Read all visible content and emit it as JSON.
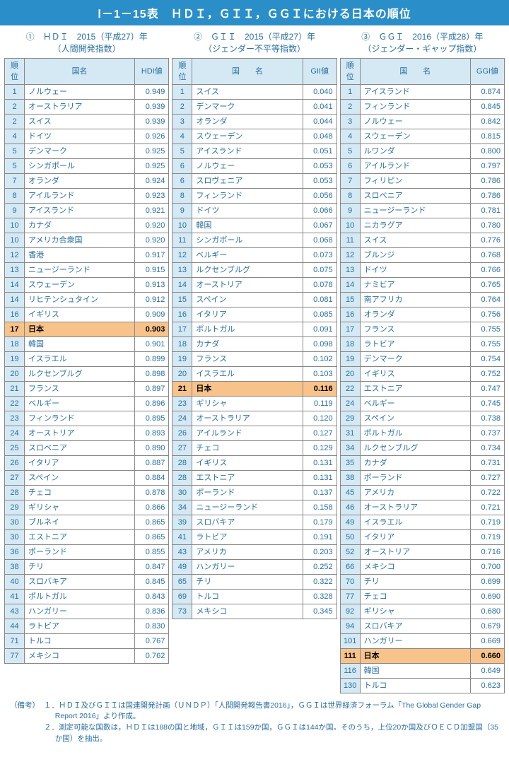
{
  "title": "Ⅰ－1－15表　ＨＤＩ，ＧＩＩ，ＧＧＩにおける日本の順位",
  "columns": [
    {
      "heading_num": "①",
      "heading_main": "ＨＤＩ　2015（平成27）年",
      "heading_sub": "（人間開発指数）",
      "head_rank": "順位",
      "head_name": "国名",
      "head_val": "HDI値",
      "rows": [
        {
          "rank": "1",
          "name": "ノルウェー",
          "val": "0.949"
        },
        {
          "rank": "2",
          "name": "オーストラリア",
          "val": "0.939"
        },
        {
          "rank": "2",
          "name": "スイス",
          "val": "0.939"
        },
        {
          "rank": "4",
          "name": "ドイツ",
          "val": "0.926"
        },
        {
          "rank": "5",
          "name": "デンマーク",
          "val": "0.925"
        },
        {
          "rank": "5",
          "name": "シンガポール",
          "val": "0.925"
        },
        {
          "rank": "7",
          "name": "オランダ",
          "val": "0.924"
        },
        {
          "rank": "8",
          "name": "アイルランド",
          "val": "0.923"
        },
        {
          "rank": "9",
          "name": "アイスランド",
          "val": "0.921"
        },
        {
          "rank": "10",
          "name": "カナダ",
          "val": "0.920"
        },
        {
          "rank": "10",
          "name": "アメリカ合衆国",
          "val": "0.920"
        },
        {
          "rank": "12",
          "name": "香港",
          "val": "0.917"
        },
        {
          "rank": "13",
          "name": "ニュージーランド",
          "val": "0.915"
        },
        {
          "rank": "14",
          "name": "スウェーデン",
          "val": "0.913"
        },
        {
          "rank": "14",
          "name": "リヒテンシュタイン",
          "val": "0.912"
        },
        {
          "rank": "16",
          "name": "イギリス",
          "val": "0.909"
        },
        {
          "rank": "17",
          "name": "日本",
          "val": "0.903",
          "hl": true
        },
        {
          "rank": "18",
          "name": "韓国",
          "val": "0.901"
        },
        {
          "rank": "19",
          "name": "イスラエル",
          "val": "0.899"
        },
        {
          "rank": "20",
          "name": "ルクセンブルグ",
          "val": "0.898"
        },
        {
          "rank": "21",
          "name": "フランス",
          "val": "0.897"
        },
        {
          "rank": "22",
          "name": "ベルギー",
          "val": "0.896"
        },
        {
          "rank": "23",
          "name": "フィンランド",
          "val": "0.895"
        },
        {
          "rank": "24",
          "name": "オーストリア",
          "val": "0.893"
        },
        {
          "rank": "25",
          "name": "スロベニア",
          "val": "0.890"
        },
        {
          "rank": "26",
          "name": "イタリア",
          "val": "0.887"
        },
        {
          "rank": "27",
          "name": "スペイン",
          "val": "0.884"
        },
        {
          "rank": "28",
          "name": "チェコ",
          "val": "0.878"
        },
        {
          "rank": "29",
          "name": "ギリシャ",
          "val": "0.866"
        },
        {
          "rank": "30",
          "name": "ブルネイ",
          "val": "0.865"
        },
        {
          "rank": "30",
          "name": "エストニア",
          "val": "0.865"
        },
        {
          "rank": "36",
          "name": "ポーランド",
          "val": "0.855"
        },
        {
          "rank": "38",
          "name": "チリ",
          "val": "0.847"
        },
        {
          "rank": "40",
          "name": "スロバキア",
          "val": "0.845"
        },
        {
          "rank": "41",
          "name": "ポルトガル",
          "val": "0.843"
        },
        {
          "rank": "43",
          "name": "ハンガリー",
          "val": "0.836"
        },
        {
          "rank": "44",
          "name": "ラトビア",
          "val": "0.830"
        },
        {
          "rank": "71",
          "name": "トルコ",
          "val": "0.767"
        },
        {
          "rank": "77",
          "name": "メキシコ",
          "val": "0.762"
        }
      ]
    },
    {
      "heading_num": "②",
      "heading_main": "ＧＩＩ　2015（平成27）年",
      "heading_sub": "（ジェンダー不平等指数）",
      "head_rank": "順位",
      "head_name": "国　　名",
      "head_val": "GII値",
      "rows": [
        {
          "rank": "1",
          "name": "スイス",
          "val": "0.040"
        },
        {
          "rank": "2",
          "name": "デンマーク",
          "val": "0.041"
        },
        {
          "rank": "3",
          "name": "オランダ",
          "val": "0.044"
        },
        {
          "rank": "4",
          "name": "スウェーデン",
          "val": "0.048"
        },
        {
          "rank": "5",
          "name": "アイスランド",
          "val": "0.051"
        },
        {
          "rank": "6",
          "name": "ノルウェー",
          "val": "0.053"
        },
        {
          "rank": "6",
          "name": "スロヴェニア",
          "val": "0.053"
        },
        {
          "rank": "8",
          "name": "フィンランド",
          "val": "0.056"
        },
        {
          "rank": "9",
          "name": "ドイツ",
          "val": "0.066"
        },
        {
          "rank": "10",
          "name": "韓国",
          "val": "0.067"
        },
        {
          "rank": "11",
          "name": "シンガポール",
          "val": "0.068"
        },
        {
          "rank": "12",
          "name": "ベルギー",
          "val": "0.073"
        },
        {
          "rank": "13",
          "name": "ルクセンブルグ",
          "val": "0.075"
        },
        {
          "rank": "14",
          "name": "オーストリア",
          "val": "0.078"
        },
        {
          "rank": "15",
          "name": "スペイン",
          "val": "0.081"
        },
        {
          "rank": "16",
          "name": "イタリア",
          "val": "0.085"
        },
        {
          "rank": "17",
          "name": "ポルトガル",
          "val": "0.091"
        },
        {
          "rank": "18",
          "name": "カナダ",
          "val": "0.098"
        },
        {
          "rank": "19",
          "name": "フランス",
          "val": "0.102"
        },
        {
          "rank": "20",
          "name": "イスラエル",
          "val": "0.103"
        },
        {
          "rank": "21",
          "name": "日本",
          "val": "0.116",
          "hl": true
        },
        {
          "rank": "23",
          "name": "ギリシャ",
          "val": "0.119"
        },
        {
          "rank": "24",
          "name": "オーストラリア",
          "val": "0.120"
        },
        {
          "rank": "26",
          "name": "アイルランド",
          "val": "0.127"
        },
        {
          "rank": "27",
          "name": "チェコ",
          "val": "0.129"
        },
        {
          "rank": "28",
          "name": "イギリス",
          "val": "0.131"
        },
        {
          "rank": "28",
          "name": "エストニア",
          "val": "0.131"
        },
        {
          "rank": "30",
          "name": "ポーランド",
          "val": "0.137"
        },
        {
          "rank": "34",
          "name": "ニュージーランド",
          "val": "0.158"
        },
        {
          "rank": "39",
          "name": "スロバキア",
          "val": "0.179"
        },
        {
          "rank": "41",
          "name": "ラトビア",
          "val": "0.191"
        },
        {
          "rank": "43",
          "name": "アメリカ",
          "val": "0.203"
        },
        {
          "rank": "49",
          "name": "ハンガリー",
          "val": "0.252"
        },
        {
          "rank": "65",
          "name": "チリ",
          "val": "0.322"
        },
        {
          "rank": "69",
          "name": "トルコ",
          "val": "0.328"
        },
        {
          "rank": "73",
          "name": "メキシコ",
          "val": "0.345"
        }
      ]
    },
    {
      "heading_num": "③",
      "heading_main": "ＧＧＩ　2016（平成28）年",
      "heading_sub": "（ジェンダー・ギャップ指数）",
      "head_rank": "順位",
      "head_name": "国　　名",
      "head_val": "GGI値",
      "rows": [
        {
          "rank": "1",
          "name": "アイスランド",
          "val": "0.874"
        },
        {
          "rank": "2",
          "name": "フィンランド",
          "val": "0.845"
        },
        {
          "rank": "3",
          "name": "ノルウェー",
          "val": "0.842"
        },
        {
          "rank": "4",
          "name": "スウェーデン",
          "val": "0.815"
        },
        {
          "rank": "5",
          "name": "ルワンダ",
          "val": "0.800"
        },
        {
          "rank": "6",
          "name": "アイルランド",
          "val": "0.797"
        },
        {
          "rank": "7",
          "name": "フィリピン",
          "val": "0.786"
        },
        {
          "rank": "8",
          "name": "スロベニア",
          "val": "0.786"
        },
        {
          "rank": "9",
          "name": "ニュージーランド",
          "val": "0.781"
        },
        {
          "rank": "10",
          "name": "ニカラグア",
          "val": "0.780"
        },
        {
          "rank": "11",
          "name": "スイス",
          "val": "0.776"
        },
        {
          "rank": "12",
          "name": "ブルンジ",
          "val": "0.768"
        },
        {
          "rank": "13",
          "name": "ドイツ",
          "val": "0.766"
        },
        {
          "rank": "14",
          "name": "ナミビア",
          "val": "0.765"
        },
        {
          "rank": "15",
          "name": "南アフリカ",
          "val": "0.764"
        },
        {
          "rank": "16",
          "name": "オランダ",
          "val": "0.756"
        },
        {
          "rank": "17",
          "name": "フランス",
          "val": "0.755"
        },
        {
          "rank": "18",
          "name": "ラトビア",
          "val": "0.755"
        },
        {
          "rank": "19",
          "name": "デンマーク",
          "val": "0.754"
        },
        {
          "rank": "20",
          "name": "イギリス",
          "val": "0.752"
        },
        {
          "rank": "22",
          "name": "エストニア",
          "val": "0.747"
        },
        {
          "rank": "24",
          "name": "ベルギー",
          "val": "0.745"
        },
        {
          "rank": "29",
          "name": "スペイン",
          "val": "0.738"
        },
        {
          "rank": "31",
          "name": "ポルトガル",
          "val": "0.737"
        },
        {
          "rank": "34",
          "name": "ルクセンブルグ",
          "val": "0.734"
        },
        {
          "rank": "35",
          "name": "カナダ",
          "val": "0.731"
        },
        {
          "rank": "38",
          "name": "ポーランド",
          "val": "0.727"
        },
        {
          "rank": "45",
          "name": "アメリカ",
          "val": "0.722"
        },
        {
          "rank": "46",
          "name": "オーストラリア",
          "val": "0.721"
        },
        {
          "rank": "49",
          "name": "イスラエル",
          "val": "0.719"
        },
        {
          "rank": "50",
          "name": "イタリア",
          "val": "0.719"
        },
        {
          "rank": "52",
          "name": "オーストリア",
          "val": "0.716"
        },
        {
          "rank": "66",
          "name": "メキシコ",
          "val": "0.700"
        },
        {
          "rank": "70",
          "name": "チリ",
          "val": "0.699"
        },
        {
          "rank": "77",
          "name": "チェコ",
          "val": "0.690"
        },
        {
          "rank": "92",
          "name": "ギリシャ",
          "val": "0.680"
        },
        {
          "rank": "94",
          "name": "スロバキア",
          "val": "0.679"
        },
        {
          "rank": "101",
          "name": "ハンガリー",
          "val": "0.669"
        },
        {
          "rank": "111",
          "name": "日本",
          "val": "0.660",
          "hl": true
        },
        {
          "rank": "116",
          "name": "韓国",
          "val": "0.649"
        },
        {
          "rank": "130",
          "name": "トルコ",
          "val": "0.623"
        }
      ]
    }
  ],
  "notes_label": "（備考）",
  "notes": [
    "１．ＨＤＩ及びＧＩＩは国連開発計画（ＵＮＤＰ）「人間開発報告書2016」，ＧＧＩは世界経済フォーラム「The Global Gender Gap Report 2016」より作成。",
    "２．測定可能な国数は，ＨＤＩは188の国と地域，ＧＩＩは159か国，ＧＧＩは144か国。そのうち，上位20か国及びＯＥＣＤ加盟国（35か国）を抽出。"
  ]
}
